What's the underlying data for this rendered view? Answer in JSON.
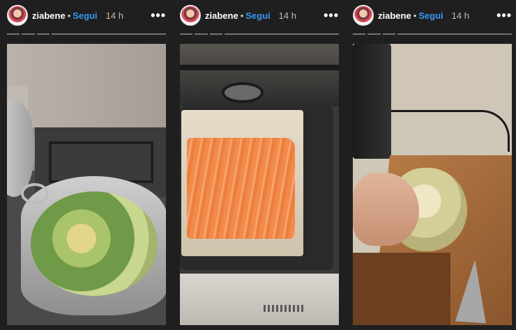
{
  "stories": [
    {
      "username": "ziabene",
      "separator": "•",
      "follow_label": "Segui",
      "time": "14 h",
      "more_label": "•••",
      "avatar_icon": "profile-avatar-icon"
    },
    {
      "username": "ziabene",
      "separator": "•",
      "follow_label": "Segui",
      "time": "14 h",
      "more_label": "•••",
      "avatar_icon": "profile-avatar-icon"
    },
    {
      "username": "ziabene",
      "separator": "•",
      "follow_label": "Segui",
      "time": "14 h",
      "more_label": "•••",
      "avatar_icon": "profile-avatar-icon"
    }
  ],
  "colors": {
    "background": "#1f1f1f",
    "follow_link": "#3897f0",
    "username": "#ffffff",
    "time": "#bdbdbd"
  }
}
